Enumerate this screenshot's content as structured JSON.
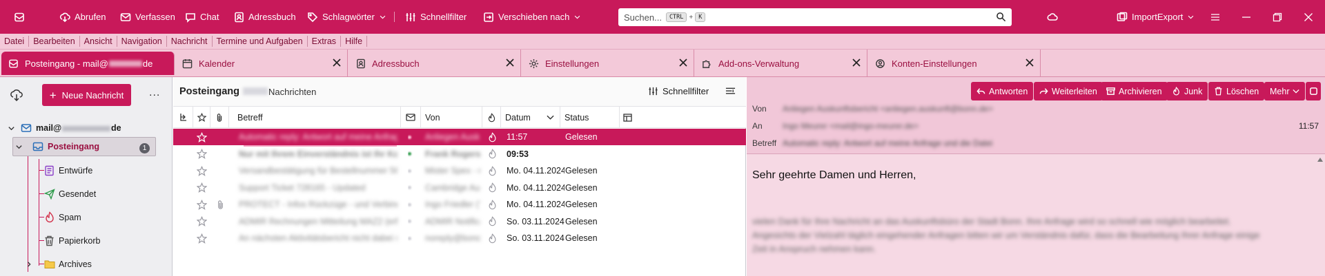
{
  "toolbar": {
    "fetch": "Abrufen",
    "compose": "Verfassen",
    "chat": "Chat",
    "addressbook": "Adressbuch",
    "tags": "Schlagwörter",
    "quickfilter": "Schnellfilter",
    "move": "Verschieben nach",
    "search_placeholder": "Suchen...",
    "search_shortcut_mod": "CTRL",
    "search_shortcut_plus": "+",
    "search_shortcut_key": "K",
    "addon": "ImportExport"
  },
  "menu": [
    "Datei",
    "Bearbeiten",
    "Ansicht",
    "Navigation",
    "Nachricht",
    "Termine und Aufgaben",
    "Extras",
    "Hilfe"
  ],
  "tabs": {
    "inbox": "Posteingang - mail@",
    "inbox_tail": "de",
    "calendar": "Kalender",
    "addressbook": "Adressbuch",
    "settings": "Einstellungen",
    "addons": "Add-ons-Verwaltung",
    "account": "Konten-Einstellungen"
  },
  "folders": {
    "new_message": "Neue Nachricht",
    "more": "...",
    "account": "mail@",
    "account_tail": "de",
    "inbox": "Posteingang",
    "inbox_count": "1",
    "drafts": "Entwürfe",
    "sent": "Gesendet",
    "spam": "Spam",
    "trash": "Papierkorb",
    "archives": "Archives"
  },
  "thread": {
    "folder_title": "Posteingang",
    "count_suffix": "Nachrichten",
    "quickfilter": "Schnellfilter",
    "columns": {
      "subject": "Betreff",
      "from": "Von",
      "date": "Datum",
      "status": "Status"
    },
    "rows": [
      {
        "date": "11:57",
        "status": "Gelesen",
        "subject": "Automatic reply: Antwort auf meine Anfrage",
        "from": "Anliegen Auskunft",
        "attach": false,
        "bold": false,
        "selected": true
      },
      {
        "date": "09:53",
        "status": "",
        "subject": "Nur mit Ihrem Einverständnis ist Ihr Konto",
        "from": "Frank Rogerson",
        "attach": false,
        "bold": true,
        "selected": false
      },
      {
        "date": "Mo. 04.11.2024, ...",
        "status": "Gelesen",
        "subject": "Versandbestätigung für Bestellnummer 56321458",
        "from": "Mister Spex - no-reply",
        "attach": false,
        "bold": false,
        "selected": false
      },
      {
        "date": "Mo. 04.11.2024, ...",
        "status": "Gelesen",
        "subject": "Support Ticket 728165 - Updated",
        "from": "Cambridge Audio",
        "attach": false,
        "bold": false,
        "selected": false
      },
      {
        "date": "Mo. 04.11.2024, ...",
        "status": "Gelesen",
        "subject": "PROTECT - Infos Rückzüge - und Verbindungsdaten nach",
        "from": "Ingo Friedler (?)",
        "attach": true,
        "bold": false,
        "selected": false
      },
      {
        "date": "So. 03.11.2024, ...",
        "status": "Gelesen",
        "subject": "ADMIR Rechnungen Mitteilung MAZ2 (erfolgreich) Gesch",
        "from": "ADMIR Notification",
        "attach": false,
        "bold": false,
        "selected": false
      },
      {
        "date": "So. 03.11.2024, ...",
        "status": "Gelesen",
        "subject": "An nächsten Aktivitätsbericht nicht dabei sein dürfen",
        "from": "noreply@bono",
        "attach": false,
        "bold": false,
        "selected": false
      }
    ]
  },
  "message": {
    "actions": {
      "reply": "Antworten",
      "forward": "Weiterleiten",
      "archive": "Archivieren",
      "junk": "Junk",
      "delete": "Löschen",
      "more": "Mehr"
    },
    "from_label": "Von",
    "to_label": "An",
    "subject_label": "Betreff",
    "from_value": "Anliegen Auskunftsbericht <anliegen.auskunft@bonn.de>",
    "to_value": "Ingo Meurer <mail@ingo-meurer.de>",
    "subject_value": "Automatic reply: Antwort auf meine Anfrage und die Datei",
    "time": "11:57",
    "greeting": "Sehr geehrte Damen und Herren,",
    "body": "vielen Dank für Ihre Nachricht an das Auskunftsbüro der Stadt Bonn. Ihre Anfrage wird so schnell wie möglich bearbeitet. Angesichts der Vielzahl täglich eingehender Anfragen bitten wir um Verständnis dafür, dass die Bearbeitung Ihrer Anfrage einige Zeit in Anspruch nehmen kann."
  },
  "colors": {
    "accent": "#c8195a",
    "tab_strip": "#f3c9d9",
    "message_header": "#f1c7d8"
  }
}
